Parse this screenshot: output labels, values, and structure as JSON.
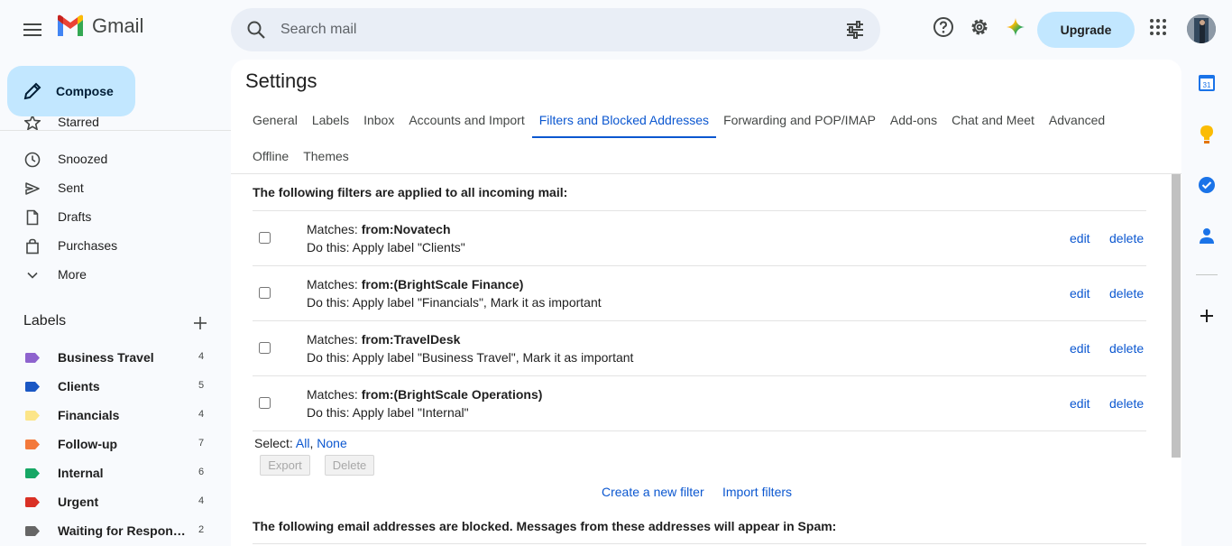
{
  "app": {
    "name": "Gmail"
  },
  "search": {
    "placeholder": "Search mail"
  },
  "header": {
    "upgrade_label": "Upgrade"
  },
  "compose": {
    "label": "Compose"
  },
  "nav": {
    "items": [
      {
        "label": "Starred",
        "icon": "star-icon"
      },
      {
        "label": "Snoozed",
        "icon": "clock-icon"
      },
      {
        "label": "Sent",
        "icon": "send-icon"
      },
      {
        "label": "Drafts",
        "icon": "draft-icon"
      },
      {
        "label": "Purchases",
        "icon": "bag-icon"
      },
      {
        "label": "More",
        "icon": "chevron-down-icon"
      }
    ]
  },
  "labels": {
    "heading": "Labels",
    "items": [
      {
        "name": "Business Travel",
        "count": "4",
        "color": "#8e63ce"
      },
      {
        "name": "Clients",
        "count": "5",
        "color": "#1a57c4"
      },
      {
        "name": "Financials",
        "count": "4",
        "color": "#fce588"
      },
      {
        "name": "Follow-up",
        "count": "7",
        "color": "#f3793b"
      },
      {
        "name": "Internal",
        "count": "6",
        "color": "#16a765"
      },
      {
        "name": "Urgent",
        "count": "4",
        "color": "#d93025"
      },
      {
        "name": "Waiting for Respon…",
        "count": "2",
        "color": "#666666"
      }
    ]
  },
  "settings": {
    "title": "Settings",
    "tabs_row1": [
      "General",
      "Labels",
      "Inbox",
      "Accounts and Import",
      "Filters and Blocked Addresses",
      "Forwarding and POP/IMAP",
      "Add-ons",
      "Chat and Meet",
      "Advanced"
    ],
    "tabs_row2": [
      "Offline",
      "Themes"
    ],
    "active_tab": "Filters and Blocked Addresses",
    "filters_heading": "The following filters are applied to all incoming mail:",
    "filters": [
      {
        "matches_prefix": "Matches: ",
        "matches": "from:Novatech",
        "action": "Do this: Apply label \"Clients\"",
        "edit": "edit",
        "delete": "delete"
      },
      {
        "matches_prefix": "Matches: ",
        "matches": "from:(BrightScale Finance)",
        "action": "Do this: Apply label \"Financials\", Mark it as important",
        "edit": "edit",
        "delete": "delete"
      },
      {
        "matches_prefix": "Matches: ",
        "matches": "from:TravelDesk",
        "action": "Do this: Apply label \"Business Travel\", Mark it as important",
        "edit": "edit",
        "delete": "delete"
      },
      {
        "matches_prefix": "Matches: ",
        "matches": "from:(BrightScale Operations)",
        "action": "Do this: Apply label \"Internal\"",
        "edit": "edit",
        "delete": "delete"
      }
    ],
    "select_prefix": "Select: ",
    "select_all": "All",
    "select_sep": ", ",
    "select_none": "None",
    "export_label": "Export",
    "delete_label": "Delete",
    "create_filter": "Create a new filter",
    "import_filters": "Import filters",
    "blocked_heading": "The following email addresses are blocked. Messages from these addresses will appear in Spam:"
  },
  "rail": {
    "calendar_day": "31"
  }
}
